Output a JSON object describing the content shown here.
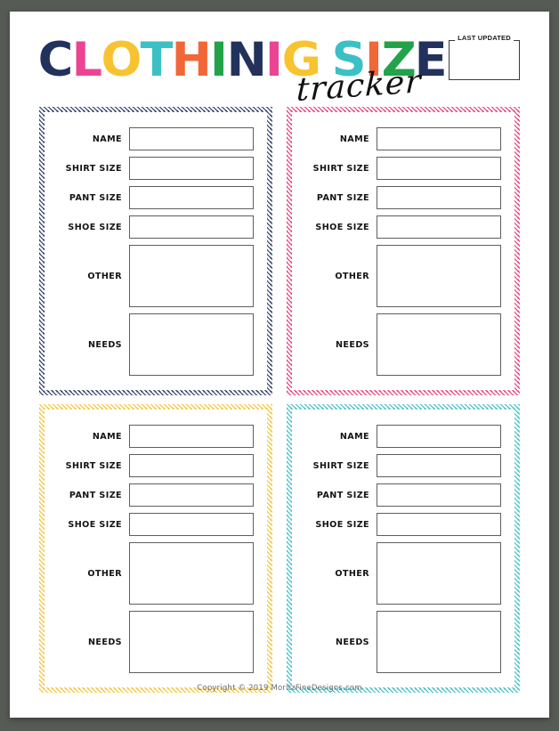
{
  "page": {
    "background_color": "#575b55",
    "paper_color": "#ffffff"
  },
  "header": {
    "title_text": "CLOTHINIG SIZE",
    "title_letters": [
      {
        "char": "C",
        "color": "#22325c"
      },
      {
        "char": "L",
        "color": "#ec4492"
      },
      {
        "char": "O",
        "color": "#f7c331"
      },
      {
        "char": "T",
        "color": "#3cc0c5"
      },
      {
        "char": "H",
        "color": "#f26738"
      },
      {
        "char": "I",
        "color": "#22a34a"
      },
      {
        "char": "N",
        "color": "#22325c"
      },
      {
        "char": "I",
        "color": "#ec4492"
      },
      {
        "char": "G",
        "color": "#f7c331"
      },
      {
        "char": "S",
        "color": "#3cc0c5"
      },
      {
        "char": "I",
        "color": "#f26738"
      },
      {
        "char": "Z",
        "color": "#22a34a"
      },
      {
        "char": "E",
        "color": "#22325c"
      }
    ],
    "script_word": "tracker",
    "last_updated": {
      "label": "LAST UPDATED",
      "value": ""
    }
  },
  "cards": [
    {
      "id": "navy",
      "accent_color": "#22325c",
      "rows": [
        {
          "label": "NAME",
          "value": "",
          "size": "short"
        },
        {
          "label": "SHIRT SIZE",
          "value": "",
          "size": "short"
        },
        {
          "label": "PANT SIZE",
          "value": "",
          "size": "short"
        },
        {
          "label": "SHOE SIZE",
          "value": "",
          "size": "short"
        },
        {
          "label": "OTHER",
          "value": "",
          "size": "tall"
        },
        {
          "label": "NEEDS",
          "value": "",
          "size": "tall"
        }
      ]
    },
    {
      "id": "pink",
      "accent_color": "#e8316f",
      "rows": [
        {
          "label": "NAME",
          "value": "",
          "size": "short"
        },
        {
          "label": "SHIRT SIZE",
          "value": "",
          "size": "short"
        },
        {
          "label": "PANT SIZE",
          "value": "",
          "size": "short"
        },
        {
          "label": "SHOE SIZE",
          "value": "",
          "size": "short"
        },
        {
          "label": "OTHER",
          "value": "",
          "size": "tall"
        },
        {
          "label": "NEEDS",
          "value": "",
          "size": "tall"
        }
      ]
    },
    {
      "id": "yellow",
      "accent_color": "#f5c025",
      "rows": [
        {
          "label": "NAME",
          "value": "",
          "size": "short"
        },
        {
          "label": "SHIRT SIZE",
          "value": "",
          "size": "short"
        },
        {
          "label": "PANT SIZE",
          "value": "",
          "size": "short"
        },
        {
          "label": "SHOE SIZE",
          "value": "",
          "size": "short"
        },
        {
          "label": "OTHER",
          "value": "",
          "size": "tall"
        },
        {
          "label": "NEEDS",
          "value": "",
          "size": "tall"
        }
      ]
    },
    {
      "id": "teal",
      "accent_color": "#33bcc4",
      "rows": [
        {
          "label": "NAME",
          "value": "",
          "size": "short"
        },
        {
          "label": "SHIRT SIZE",
          "value": "",
          "size": "short"
        },
        {
          "label": "PANT SIZE",
          "value": "",
          "size": "short"
        },
        {
          "label": "SHOE SIZE",
          "value": "",
          "size": "short"
        },
        {
          "label": "OTHER",
          "value": "",
          "size": "tall"
        },
        {
          "label": "NEEDS",
          "value": "",
          "size": "tall"
        }
      ]
    }
  ],
  "footer": {
    "copyright": "Copyright © 2019 MoritzFineDesigns.com"
  }
}
